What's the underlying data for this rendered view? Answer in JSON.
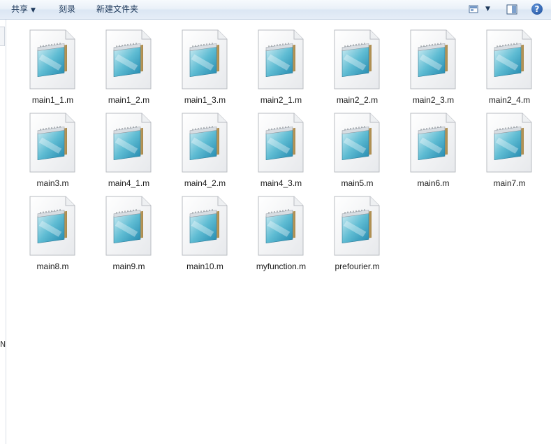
{
  "toolbar": {
    "share_label": "共享",
    "share_arrow": "▼",
    "burn_label": "刻录",
    "new_folder_label": "新建文件夹",
    "view_icon": "view-options-icon",
    "view_arrow": "▼",
    "preview_pane_icon": "preview-pane-icon",
    "help_icon": "help-icon",
    "help_glyph": "?"
  },
  "left_pane": {
    "truncated_glyph": "N"
  },
  "files": [
    {
      "name": "main1_1.m"
    },
    {
      "name": "main1_2.m"
    },
    {
      "name": "main1_3.m"
    },
    {
      "name": "main2_1.m"
    },
    {
      "name": "main2_2.m"
    },
    {
      "name": "main2_3.m"
    },
    {
      "name": "main2_4.m"
    },
    {
      "name": "main3.m"
    },
    {
      "name": "main4_1.m"
    },
    {
      "name": "main4_2.m"
    },
    {
      "name": "main4_3.m"
    },
    {
      "name": "main5.m"
    },
    {
      "name": "main6.m"
    },
    {
      "name": "main7.m"
    },
    {
      "name": "main8.m"
    },
    {
      "name": "main9.m"
    },
    {
      "name": "main10.m"
    },
    {
      "name": "myfunction.m"
    },
    {
      "name": "prefourier.m"
    }
  ],
  "file_icon": "notepad-document-icon"
}
